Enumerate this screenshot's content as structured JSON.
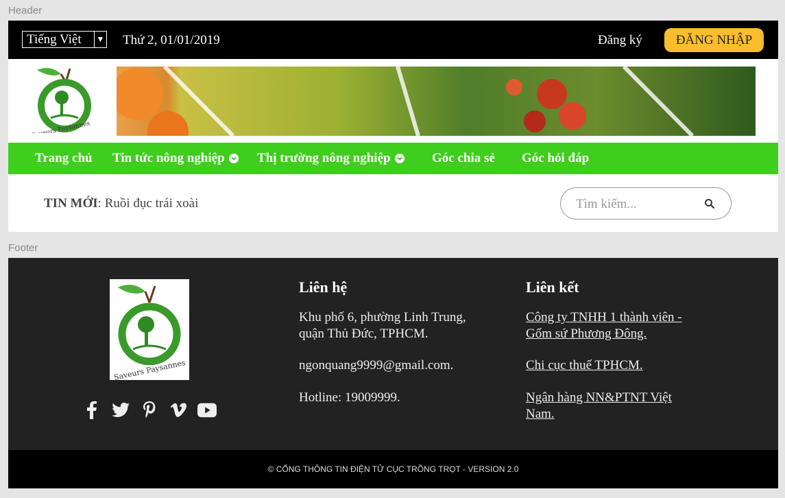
{
  "captions": {
    "header": "Header",
    "footer": "Footer"
  },
  "topbar": {
    "language": "Tiếng Việt",
    "date": "Thứ 2, 01/01/2019",
    "register_label": "Đăng ký",
    "login_label": "ĐĂNG NHẬP"
  },
  "brand": {
    "logo_text": "Saveurs Paysannes"
  },
  "nav": {
    "items": [
      {
        "label": "Trang chủ"
      },
      {
        "label": "Tin tức nông nghiệp"
      },
      {
        "label": "Thị trường nông nghiệp"
      },
      {
        "label": "Góc chia sẻ"
      },
      {
        "label": "Góc hỏi đáp"
      }
    ]
  },
  "news": {
    "label": "TIN MỚI",
    "headline": "Ruồi đục trái xoài"
  },
  "search": {
    "placeholder": "Tìm kiếm..."
  },
  "footer": {
    "logo_text": "Saveurs Paysannes",
    "contact": {
      "title": "Liên hệ",
      "address_line1": "Khu phố 6, phường Linh Trung,",
      "address_line2": "quận Thủ Đức, TPHCM.",
      "email": "ngonquang9999@gmail.com.",
      "hotline": "Hotline: 19009999."
    },
    "links": {
      "title": "Liên kết",
      "items": [
        {
          "line1": "Công ty TNHH 1 thành viên -",
          "line2": "Gốm sứ Phương Đông."
        },
        {
          "line1": "Chi cục thuế TPHCM.",
          "line2": ""
        },
        {
          "line1": "Ngân hàng NN&PTNT Việt",
          "line2": "Nam."
        }
      ]
    },
    "copyright": "© CỔNG THÔNG TIN ĐIỆN TỬ CỤC TRỒNG TRỌT - VERSION 2.0"
  },
  "colors": {
    "nav_green": "#3fcd1e",
    "login_yellow": "#fbbd2b",
    "footer_bg": "#222222"
  }
}
